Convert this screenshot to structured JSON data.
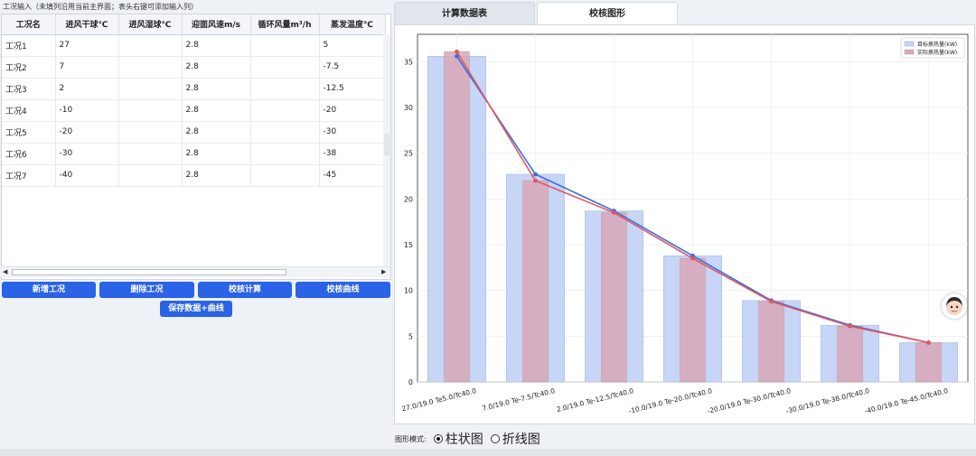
{
  "left": {
    "hint": "工况输入（未填列沿用当前主界面；表头右键可添加输入列）",
    "columns": [
      "工况名",
      "进风干球℃",
      "进风湿球℃",
      "迎面风速m/s",
      "循环风量m³/h",
      "蒸发温度℃"
    ],
    "rows": [
      [
        "工况1",
        "27",
        "",
        "2.8",
        "",
        "5"
      ],
      [
        "工况2",
        "7",
        "",
        "2.8",
        "",
        "-7.5"
      ],
      [
        "工况3",
        "2",
        "",
        "2.8",
        "",
        "-12.5"
      ],
      [
        "工况4",
        "-10",
        "",
        "2.8",
        "",
        "-20"
      ],
      [
        "工况5",
        "-20",
        "",
        "2.8",
        "",
        "-30"
      ],
      [
        "工况6",
        "-30",
        "",
        "2.8",
        "",
        "-38"
      ],
      [
        "工况7",
        "-40",
        "",
        "2.8",
        "",
        "-45"
      ]
    ],
    "buttons": {
      "add": "新增工况",
      "delete": "删除工况",
      "calc": "校核计算",
      "curve": "校核曲线",
      "save": "保存数据+曲线"
    }
  },
  "tabs": {
    "calc": "计算数据表",
    "chart": "校核图形"
  },
  "mode": {
    "label": "图形模式:",
    "bar": "柱状图",
    "line": "折线图"
  },
  "status": "",
  "colors": {
    "accent": "#2a63e6",
    "target_bar": "#c7d5f6",
    "actual_bar": "#d9a8b8",
    "target_line": "#3a6fd8",
    "actual_line": "#e05563"
  },
  "chart_data": {
    "type": "bar",
    "categories": [
      "27.0/19.0 Te5.0/Tc40.0",
      "7.0/19.0 Te-7.5/Tc40.0",
      "2.0/19.0 Te-12.5/Tc40.0",
      "-10.0/19.0 Te-20.0/Tc40.0",
      "-20.0/19.0 Te-30.0/Tc40.0",
      "-30.0/19.0 Te-38.0/Tc40.0",
      "-40.0/19.0 Te-45.0/Tc40.0"
    ],
    "series": [
      {
        "name": "目标换热量(kW)",
        "values": [
          35.6,
          22.7,
          18.7,
          13.8,
          8.9,
          6.2,
          4.3
        ]
      },
      {
        "name": "实际换热量(kW)",
        "values": [
          36.1,
          22.0,
          18.5,
          13.5,
          8.8,
          6.1,
          4.3
        ]
      }
    ],
    "yticks": [
      "0",
      "5",
      "10",
      "15",
      "20",
      "25",
      "30",
      "35"
    ],
    "ylim": [
      0,
      38
    ],
    "grid": true,
    "legend": "top-right"
  }
}
